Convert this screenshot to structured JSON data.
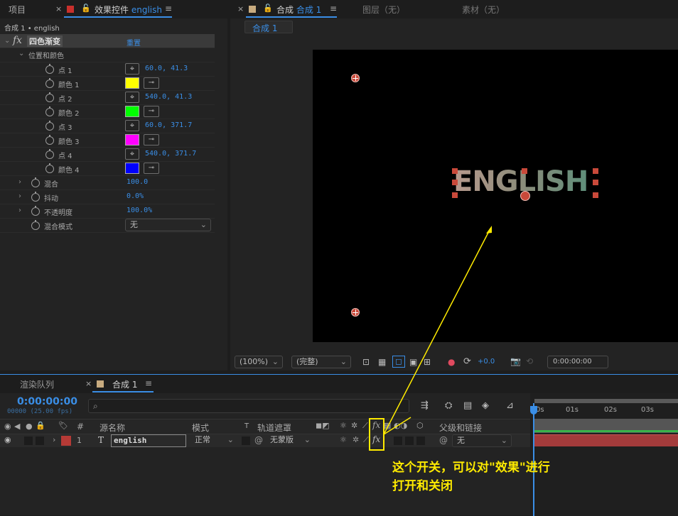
{
  "effect_controls_panel": {
    "tab_project": "项目",
    "tab_effect_controls": "效果控件",
    "tab_effect_layer": "english",
    "breadcrumb": "合成 1 • english",
    "effect_name": "四色渐变",
    "reset_label": "重置",
    "group_label": "位置和颜色",
    "params": [
      {
        "label": "点 1",
        "kind": "point",
        "value": "60.0, 41.3"
      },
      {
        "label": "颜色 1",
        "kind": "color",
        "color": "#ffff00"
      },
      {
        "label": "点 2",
        "kind": "point",
        "value": "540.0, 41.3"
      },
      {
        "label": "颜色 2",
        "kind": "color",
        "color": "#00ff00"
      },
      {
        "label": "点 3",
        "kind": "point",
        "value": "60.0, 371.7"
      },
      {
        "label": "颜色 3",
        "kind": "color",
        "color": "#ff00ff"
      },
      {
        "label": "点 4",
        "kind": "point",
        "value": "540.0, 371.7"
      },
      {
        "label": "颜色 4",
        "kind": "color",
        "color": "#0000ff"
      }
    ],
    "blend_label": "混合",
    "blend_value": "100.0",
    "jitter_label": "抖动",
    "jitter_value": "0.0%",
    "opacity_label": "不透明度",
    "opacity_value": "100.0%",
    "blend_mode_label": "混合模式",
    "blend_mode_value": "无"
  },
  "composition_panel": {
    "tab_comp_prefix": "合成",
    "tab_comp_name": "合成 1",
    "tab_layer": "图层（无）",
    "tab_footage": "素材（无）",
    "subtab": "合成 1",
    "text_layer": "ENGLISH",
    "zoom": "(100%)",
    "resolution": "(完整)",
    "exposure": "+0.0",
    "timecode": "0:00:00:00"
  },
  "timeline_panel": {
    "tab_render_queue": "渲染队列",
    "tab_comp": "合成 1",
    "current_time": "0:00:00:00",
    "fps_label": "00000 (25.00 fps)",
    "search_placeholder": "",
    "col_num": "#",
    "col_source": "源名称",
    "col_mode": "模式",
    "col_t": "T",
    "col_trackmatte": "轨道遮罩",
    "col_parent": "父级和链接",
    "ruler": [
      "0s",
      "01s",
      "02s",
      "03s"
    ],
    "layer": {
      "index": "1",
      "type": "T",
      "name": "english",
      "mode": "正常",
      "trackmatte": "无蒙版",
      "parent": "无",
      "label_color": "#b53a36"
    }
  },
  "annotation": {
    "line1": "这个开关，可以对\"效果\"进行",
    "line2": "打开和关闭",
    "color": "#ffeb00"
  }
}
